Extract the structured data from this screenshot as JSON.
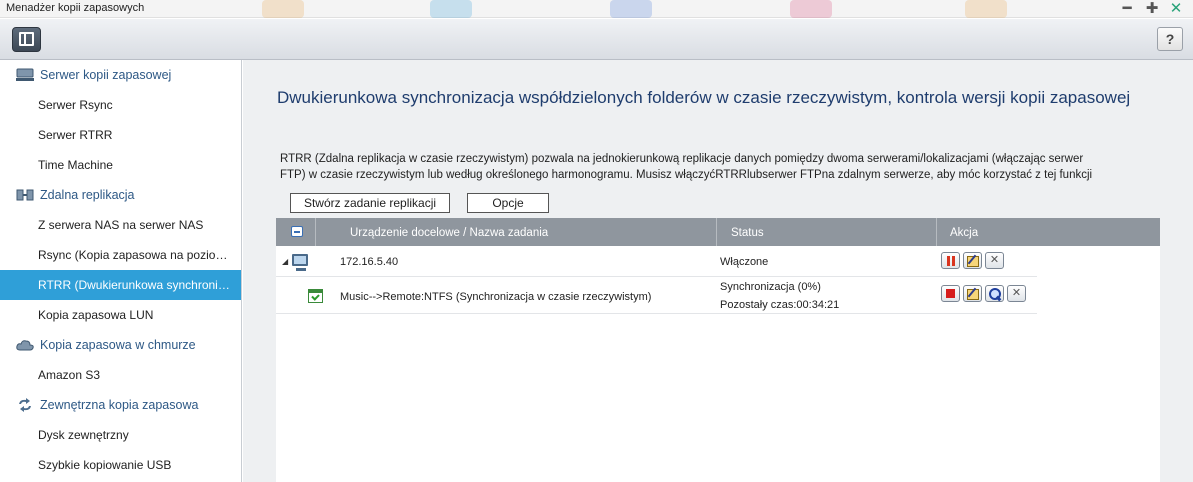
{
  "window": {
    "title": "Menadżer kopii zapasowych",
    "minimize_glyph": "━",
    "maximize_glyph": "✚",
    "close_glyph": "✕"
  },
  "toolbar": {
    "help_label": "?"
  },
  "sidebar": {
    "categories": [
      {
        "label": "Serwer kopii zapasowej",
        "icon": "server-icon"
      },
      {
        "label": "Zdalna replikacja",
        "icon": "replication-icon"
      },
      {
        "label": "Kopia zapasowa w chmurze",
        "icon": "cloud-icon"
      },
      {
        "label": "Zewnętrzna kopia zapasowa",
        "icon": "sync-arrows-icon"
      }
    ],
    "items": [
      {
        "label": "Serwer Rsync"
      },
      {
        "label": "Serwer RTRR"
      },
      {
        "label": "Time Machine"
      },
      {
        "label": "Z serwera NAS na serwer NAS"
      },
      {
        "label": "Rsync (Kopia zapasowa na poziomie plików)"
      },
      {
        "label": "RTRR (Dwukierunkowa synchronizacja)"
      },
      {
        "label": "Kopia zapasowa LUN"
      },
      {
        "label": "Amazon S3"
      },
      {
        "label": "Dysk zewnętrzny"
      },
      {
        "label": "Szybkie kopiowanie USB"
      }
    ],
    "active_item": "RTRR (Dwukierunkowa synchronizacja)",
    "active_color": "#2f9fd8"
  },
  "main": {
    "heading": "Dwukierunkowa synchronizacja współdzielonych folderów w czasie rzeczywistym, kontrola wersji kopii zapasowej",
    "description_line1": "RTRR (Zdalna replikacja w czasie rzeczywistym) pozwala na jednokierunkową replikacje danych pomiędzy dwoma serwerami/lokalizacjami (włączając serwer",
    "description_line2": "FTP) w czasie rzeczywistym lub według określonego harmonogramu. Musisz włączyćRTRRlubserwer FTPna zdalnym serwerze, aby móc korzystać z tej funkcji",
    "tabs": {
      "create_label": "Stwórz zadanie replikacji",
      "options_label": "Opcje"
    },
    "table": {
      "headers": {
        "name": "Urządzenie docelowe / Nazwa zadania",
        "status": "Status",
        "action": "Akcja"
      },
      "rows": [
        {
          "name": "172.16.5.40",
          "status": "Włączone",
          "icon": "computer-icon",
          "actions": [
            "pause",
            "edit",
            "delete"
          ]
        },
        {
          "name": "Music-->Remote:NTFS (Synchronizacja w czasie rzeczywistym)",
          "status_line1": "Synchronizacja (0%)",
          "status_line2": "Pozostały czas:00:34:21",
          "icon": "task-icon",
          "actions": [
            "stop",
            "edit",
            "view-log",
            "delete"
          ]
        }
      ]
    }
  },
  "colors": {
    "heading": "#1f3d6e",
    "category": "#2d5885",
    "table_header": "#8f969e",
    "close_button": "#2aa37a"
  }
}
